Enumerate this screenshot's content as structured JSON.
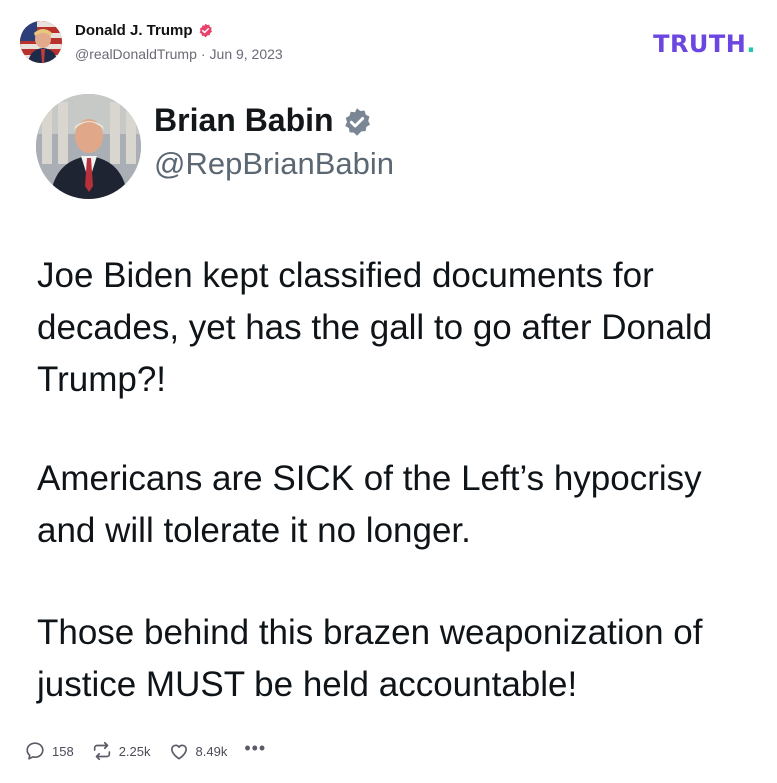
{
  "post": {
    "author_name": "Donald J. Trump",
    "handle": "@realDonaldTrump",
    "date": "Jun 9, 2023",
    "logo_text": "TRUTH",
    "logo_dot": "."
  },
  "embedded": {
    "name": "Brian Babin",
    "handle": "@RepBrianBabin",
    "paragraphs": [
      "Joe Biden kept classified documents for decades, yet has the gall to go after Donald Trump?!",
      "Americans are SICK of the Left’s hypocrisy and will tolerate it no longer.",
      "Those behind this brazen weaponization of justice MUST be held accountable!"
    ]
  },
  "actions": {
    "replies": "158",
    "retruths": "2.25k",
    "likes": "8.49k",
    "more": "•••"
  },
  "colors": {
    "brand_purple": "#6b46e0",
    "brand_teal": "#20c9a7",
    "truth_verified": "#e8436b",
    "x_verified": "#7a8693",
    "meta_gray": "#6b6b78"
  },
  "icons": [
    "verified-badge-icon",
    "reply-icon",
    "retruth-icon",
    "like-icon",
    "more-icon"
  ]
}
